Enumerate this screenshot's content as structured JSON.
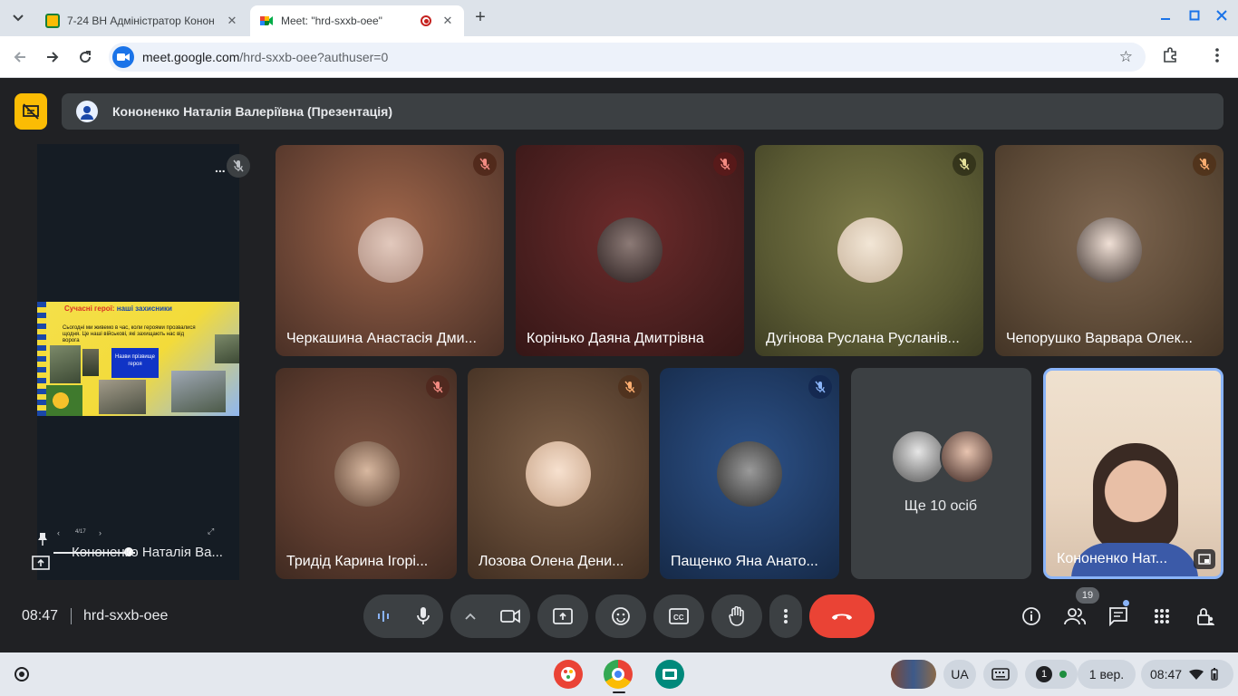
{
  "browser": {
    "tabs": [
      {
        "title": "7-24 ВН Адміністратор Конон",
        "active": false,
        "favicon": "classroom-icon"
      },
      {
        "title": "Meet: \"hrd-sxxb-oee\"",
        "active": true,
        "favicon": "meet-icon",
        "recording": true
      }
    ],
    "url_host": "meet.google.com",
    "url_path": "/hrd-sxxb-oee?authuser=0"
  },
  "presentation_bar": {
    "title": "Кононенко Наталія Валеріївна (Презентація)"
  },
  "presentation_tile": {
    "more": "...",
    "slide_title_red": "Сучасні герої: ",
    "slide_title_blue": "наші захисники",
    "slide_text": "Сьогодні ми живемо в час, коли героями прозвалися щодня. Це наші військові, які захищають нас від ворога",
    "slide_box": "Назви прізвище героя",
    "slide_counter": "4/17",
    "name": "Кононенко Наталія Ва..."
  },
  "participants": [
    {
      "name": "Черкашина Анастасія Дми...",
      "bg": "#6b4535",
      "avatar": "#c7a99a",
      "muted": true
    },
    {
      "name": "Корінько Даяна Дмитрівна",
      "bg": "#4a1f1f",
      "avatar": "#3b2a2a",
      "muted": true
    },
    {
      "name": "Дугінова Руслана Русланів...",
      "bg": "#5a5a33",
      "avatar": "#e3d6c2",
      "muted": true
    },
    {
      "name": "Чепорушко Варвара Олек...",
      "bg": "#5d4a37",
      "avatar": "#d8c4b3",
      "muted": true
    },
    {
      "name": "Тридід Карина Ігорі...",
      "bg": "#5a3a2d",
      "avatar": "#9c7a63",
      "muted": true
    },
    {
      "name": "Лозова Олена Дени...",
      "bg": "#5b4331",
      "avatar": "#e7cdb8",
      "muted": true
    },
    {
      "name": "Пащенко Яна Анато...",
      "bg": "#1f3a63",
      "avatar": "#5a5a5a",
      "muted": true
    }
  ],
  "more_tile": {
    "label": "Ще 10 осіб"
  },
  "self_tile": {
    "name": "Кононенко Нат..."
  },
  "bottom_bar": {
    "time": "08:47",
    "meeting_code": "hrd-sxxb-oee",
    "people_count": "19"
  },
  "shelf": {
    "language": "UA",
    "notifications": "1",
    "date": "1 вер.",
    "time": "08:47"
  },
  "colors": {
    "meet_bg": "#202124",
    "accent_blue": "#1a73e8",
    "end_call_red": "#ea4335",
    "presenting_yellow": "#fbbc04",
    "self_tile_border": "#8ab4f8"
  }
}
